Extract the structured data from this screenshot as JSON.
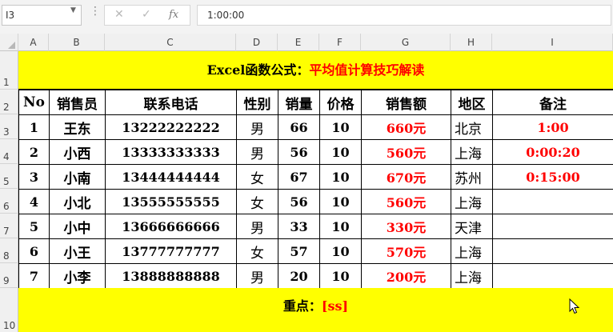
{
  "formula_bar": {
    "name_box": "I3",
    "formula": "1:00:00"
  },
  "columns": [
    "A",
    "B",
    "C",
    "D",
    "E",
    "F",
    "G",
    "H",
    "I"
  ],
  "rows": [
    "1",
    "2",
    "3",
    "4",
    "5",
    "6",
    "7",
    "8",
    "9",
    "10"
  ],
  "title": {
    "black_part": "Excel函数公式：",
    "red_part": "平均值计算技巧解读"
  },
  "table": {
    "headers": [
      "No",
      "销售员",
      "联系电话",
      "性别",
      "销量",
      "价格",
      "销售额",
      "地区",
      "备注"
    ],
    "rows": [
      [
        "1",
        "王东",
        "13222222222",
        "男",
        "66",
        "10",
        "660元",
        "北京",
        "1:00"
      ],
      [
        "2",
        "小西",
        "13333333333",
        "男",
        "56",
        "10",
        "560元",
        "上海",
        "0:00:20"
      ],
      [
        "3",
        "小南",
        "13444444444",
        "女",
        "67",
        "10",
        "670元",
        "苏州",
        "0:15:00"
      ],
      [
        "4",
        "小北",
        "13555555555",
        "女",
        "56",
        "10",
        "560元",
        "上海",
        ""
      ],
      [
        "5",
        "小中",
        "13666666666",
        "男",
        "33",
        "10",
        "330元",
        "天津",
        ""
      ],
      [
        "6",
        "小王",
        "13777777777",
        "女",
        "57",
        "10",
        "570元",
        "上海",
        ""
      ],
      [
        "7",
        "小李",
        "13888888888",
        "男",
        "20",
        "10",
        "200元",
        "上海",
        ""
      ]
    ]
  },
  "note": {
    "black_part": "重点：",
    "red_part": "[ss]"
  },
  "colors": {
    "banner": "#ffff00",
    "accent_red": "#ff0000"
  }
}
